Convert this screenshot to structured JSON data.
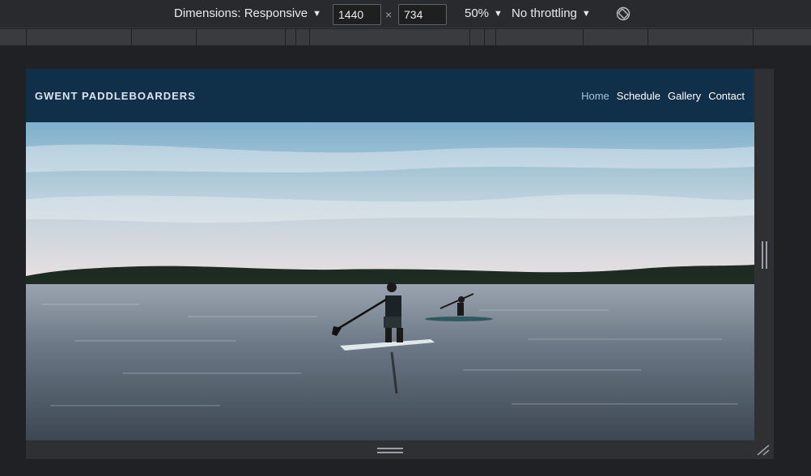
{
  "devtools": {
    "dimensions_label": "Dimensions: Responsive",
    "width_value": "1440",
    "height_value": "734",
    "times_symbol": "×",
    "zoom_label": "50%",
    "throttling_label": "No throttling",
    "caret": "▼"
  },
  "site": {
    "brand": "GWENT PADDLEBOARDERS",
    "nav": [
      "Home",
      "Schedule",
      "Gallery",
      "Contact"
    ],
    "active_nav": "Home",
    "colors": {
      "header_bg": "#10304a",
      "active_link": "#a9c3d8"
    }
  },
  "icons": {
    "rotate": "rotate-icon",
    "scroll_down": "chevron-down-icon",
    "resize_corner": "resize-corner-icon"
  }
}
